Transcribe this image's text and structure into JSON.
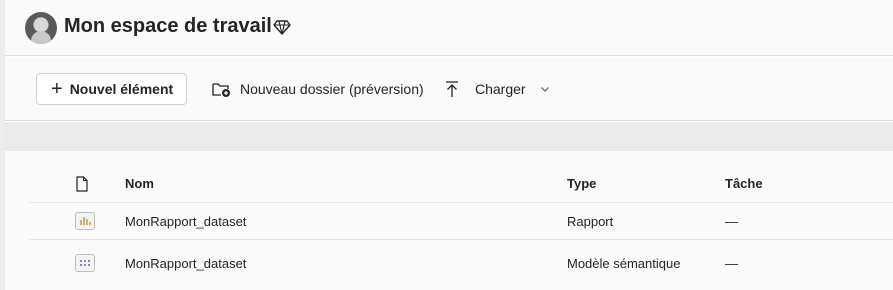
{
  "header": {
    "title": "Mon espace de travail",
    "avatar_icon": "user-avatar",
    "premium_icon": "diamond-icon"
  },
  "toolbar": {
    "new_item_label": "Nouvel élément",
    "new_folder_label": "Nouveau dossier (préversion)",
    "upload_label": "Charger"
  },
  "table": {
    "columns": {
      "icon": "file-icon",
      "name": "Nom",
      "type": "Type",
      "task": "Tâche"
    },
    "rows": [
      {
        "icon": "report-icon",
        "name": "MonRapport_dataset",
        "type": "Rapport",
        "task": "—"
      },
      {
        "icon": "semantic-model-icon",
        "name": "MonRapport_dataset",
        "type": "Modèle sémantique",
        "task": "—"
      }
    ]
  },
  "colors": {
    "accent_report": "#c8a04a",
    "accent_model": "#6f5fa8",
    "text": "#242424",
    "band": "#ebebeb"
  }
}
